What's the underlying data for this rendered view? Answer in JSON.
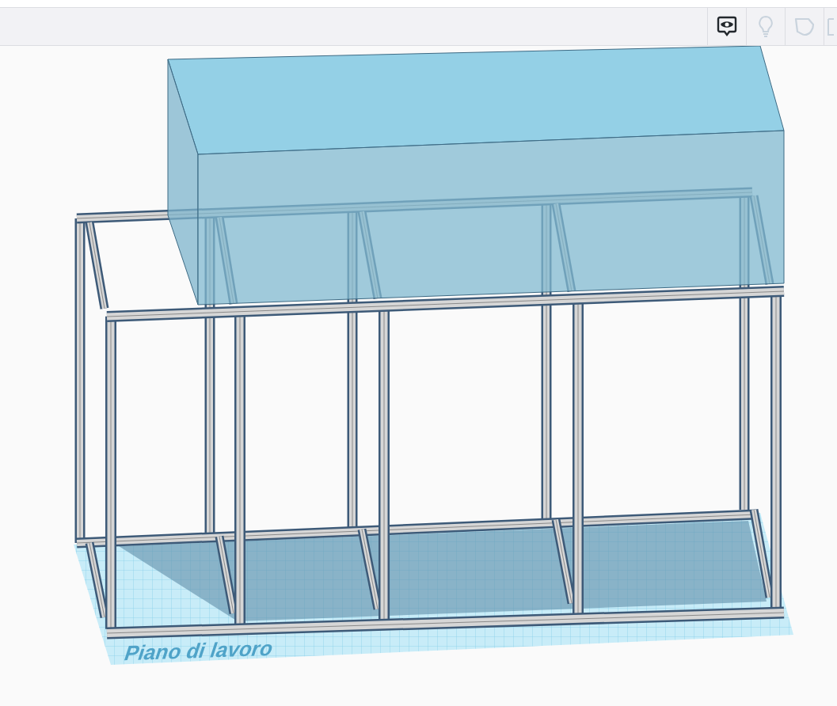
{
  "toolbar": [
    {
      "kind": "eye",
      "disabled": false
    },
    {
      "kind": "bulb",
      "disabled": true
    },
    {
      "kind": "shape",
      "disabled": true
    },
    {
      "kind": "box",
      "disabled": true
    }
  ],
  "workplane": {
    "label": "Piano di lavoro"
  }
}
